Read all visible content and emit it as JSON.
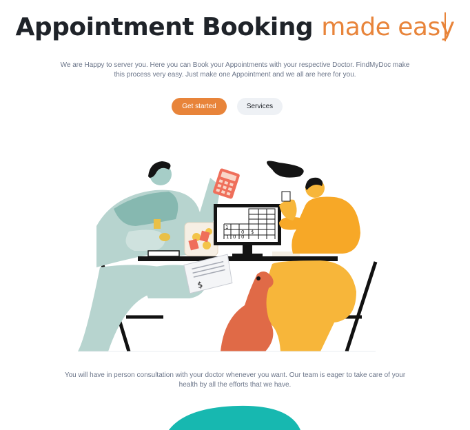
{
  "hero": {
    "title_main": "Appointment Booking",
    "title_accent": "made easy",
    "intro": "We are Happy to server you. Here you can Book your Appointments with your respective Doctor. FindMyDoc make this process very easy. Just make one Appointment and we all are here for you."
  },
  "actions": {
    "primary_label": "Get started",
    "secondary_label": "Services"
  },
  "illustration": {
    "monitor_cells": [
      "1",
      "0",
      "$",
      "1",
      "0",
      "0"
    ],
    "receipt_symbol": "$"
  },
  "caption": "You will have in person consultation with your doctor whenever you want. Our team is eager to take care of your health by all the efforts that we have.",
  "colors": {
    "accent": "#e8843a",
    "heading": "#1f2329",
    "body_text": "#6b7589",
    "secondary_button_bg": "#eef1f5",
    "teal": "#17b8b0"
  }
}
